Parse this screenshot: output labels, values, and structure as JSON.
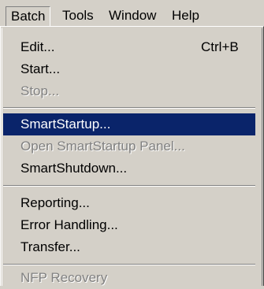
{
  "menubar": {
    "items": [
      {
        "label": "Batch"
      },
      {
        "label": "Tools"
      },
      {
        "label": "Window"
      },
      {
        "label": "Help"
      }
    ]
  },
  "batch_menu": {
    "groups": [
      [
        {
          "label": "Edit...",
          "shortcut": "Ctrl+B",
          "enabled": true
        },
        {
          "label": "Start...",
          "enabled": true
        },
        {
          "label": "Stop...",
          "enabled": false
        }
      ],
      [
        {
          "label": "SmartStartup...",
          "enabled": true,
          "highlighted": true
        },
        {
          "label": "Open SmartStartup Panel...",
          "enabled": false
        },
        {
          "label": "SmartShutdown...",
          "enabled": true
        }
      ],
      [
        {
          "label": "Reporting...",
          "enabled": true
        },
        {
          "label": "Error Handling...",
          "enabled": true
        },
        {
          "label": "Transfer...",
          "enabled": true
        }
      ],
      [
        {
          "label": "NFP Recovery",
          "enabled": false
        }
      ]
    ]
  },
  "colors": {
    "menu_background": "#d4d0c8",
    "highlight_background": "#0a246a",
    "highlight_text": "#ffffff",
    "disabled_text": "#808080"
  }
}
